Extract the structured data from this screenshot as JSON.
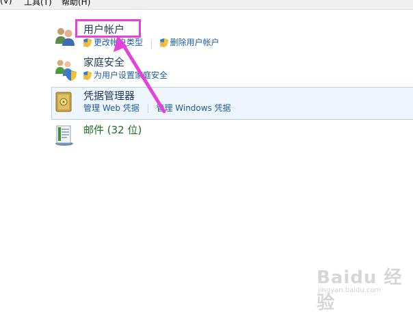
{
  "menu": [
    "(V)",
    "工具(T)",
    "帮助(H)"
  ],
  "categories": {
    "user_accounts": {
      "title": "用户帐户",
      "link1": "更改帐户类型",
      "link2": "删除用户帐户"
    },
    "family_safety": {
      "title": "家庭安全",
      "link1": "为用户设置家庭安全"
    },
    "credential_manager": {
      "title": "凭据管理器",
      "link1": "管理 Web 凭据",
      "link2": "管理 Windows 凭据"
    },
    "mail": {
      "title": "邮件 (32 位)"
    }
  },
  "watermark": {
    "brand": "Baidu 经验",
    "url": "jingyan.baidu.com"
  },
  "colors": {
    "annotation": "#e542d9",
    "link": "#1a5a9c",
    "highlight": "#eef5fd"
  },
  "icons": [
    "users-icon",
    "shield-icon",
    "family-icon",
    "vault-icon",
    "mail-icon"
  ]
}
